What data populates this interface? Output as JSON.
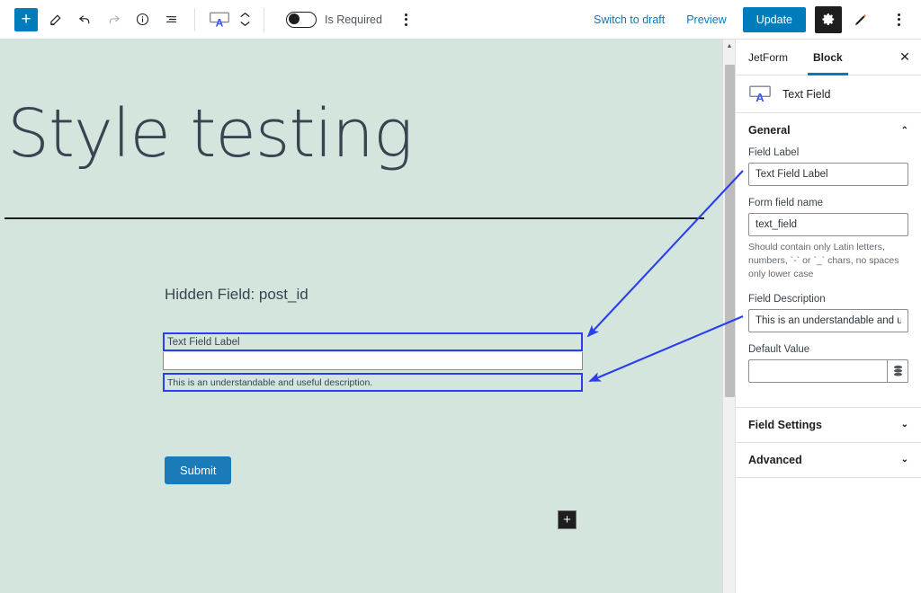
{
  "topbar": {
    "add_block": "+",
    "icons": [
      {
        "name": "edit-pencil-icon",
        "glyph": "✎"
      },
      {
        "name": "undo-icon",
        "glyph": "↩"
      },
      {
        "name": "redo-icon",
        "glyph": "↪"
      },
      {
        "name": "info-icon",
        "glyph": "ⓘ"
      },
      {
        "name": "list-view-icon",
        "glyph": "☰"
      }
    ],
    "block_type_icon": "text-field-block-icon",
    "stepper_icon": "move-up-down-icon",
    "toggle": {
      "label": "Is Required",
      "state": "off"
    },
    "kebab_icon": "more-options-icon",
    "switch_to_draft": "Switch to draft",
    "preview": "Preview",
    "update": "Update",
    "gear_icon": "settings-gear-icon",
    "pen_icon": "styles-brush-icon",
    "right_kebab_icon": "options-kebab-icon"
  },
  "canvas": {
    "post_title": "Style testing",
    "hidden_field_text": "Hidden Field: post_id",
    "field": {
      "label": "Text Field Label",
      "input_value": "",
      "description": "This is an understandable and useful description."
    },
    "submit_label": "Submit",
    "inserter_plus": "+",
    "bg_color": "#d4e5de",
    "highlight_color": "#2a3ef0",
    "submit_color": "#1b7bb8"
  },
  "sidebar": {
    "tabs": [
      {
        "label": "JetForm",
        "active": false
      },
      {
        "label": "Block",
        "active": true
      }
    ],
    "close_icon": "✕",
    "block_name": "Text Field",
    "block_icon": "text-field-block-icon",
    "panels": [
      {
        "title": "General",
        "expanded": true,
        "chevron": "⌃"
      },
      {
        "title": "Field Settings",
        "expanded": false,
        "chevron": "⌄"
      },
      {
        "title": "Advanced",
        "expanded": false,
        "chevron": "⌄"
      }
    ],
    "fields": {
      "field_label": {
        "label": "Field Label",
        "value": "Text Field Label",
        "placeholder": ""
      },
      "form_field_name": {
        "label": "Form field name",
        "value": "text_field",
        "help": "Should contain only Latin letters, numbers, `-` or `_` chars, no spaces only lower case"
      },
      "field_description": {
        "label": "Field Description",
        "value": "This is an understandable and useful des"
      },
      "default_value": {
        "label": "Default Value",
        "value": "",
        "macro_icon": "database-macro-icon"
      }
    },
    "accent_color": "#007cba"
  },
  "scrollbar": {
    "up_arrow": "▲"
  }
}
